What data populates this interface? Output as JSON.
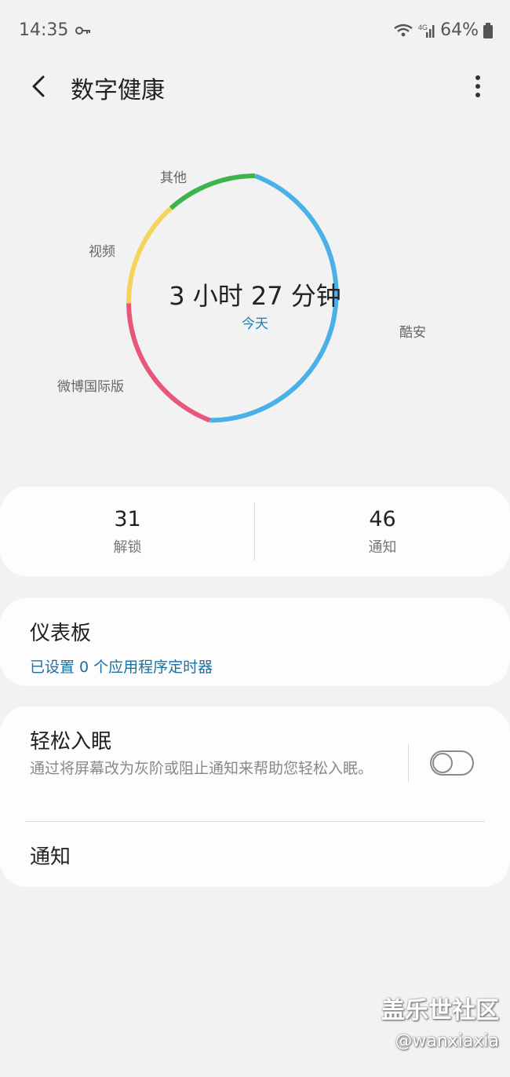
{
  "status_bar": {
    "time": "14:35",
    "network": "4G",
    "battery": "64%"
  },
  "app_bar": {
    "title": "数字健康",
    "back_icon": "chevron-left-icon",
    "more_icon": "more-vertical-icon"
  },
  "usage": {
    "total": "3 小时 27 分钟",
    "period": "今天",
    "apps": [
      {
        "name": "酷安",
        "color": "#4ab0e8"
      },
      {
        "name": "微博国际版",
        "color": "#e8577a"
      },
      {
        "name": "视频",
        "color": "#f5d45e"
      },
      {
        "name": "其他",
        "color": "#3cb44b"
      }
    ]
  },
  "stats": {
    "unlock_count": "31",
    "unlock_label": "解锁",
    "notif_count": "46",
    "notif_label": "通知"
  },
  "dashboard": {
    "title": "仪表板",
    "subtitle": "已设置 0 个应用程序定时器"
  },
  "wind_down": {
    "title": "轻松入眠",
    "description": "通过将屏幕改为灰阶或阻止通知来帮助您轻松入眠。",
    "enabled": false
  },
  "notifications": {
    "title": "通知"
  },
  "watermark": {
    "name": "盖乐世社区",
    "user": "@wanxiaxia"
  }
}
